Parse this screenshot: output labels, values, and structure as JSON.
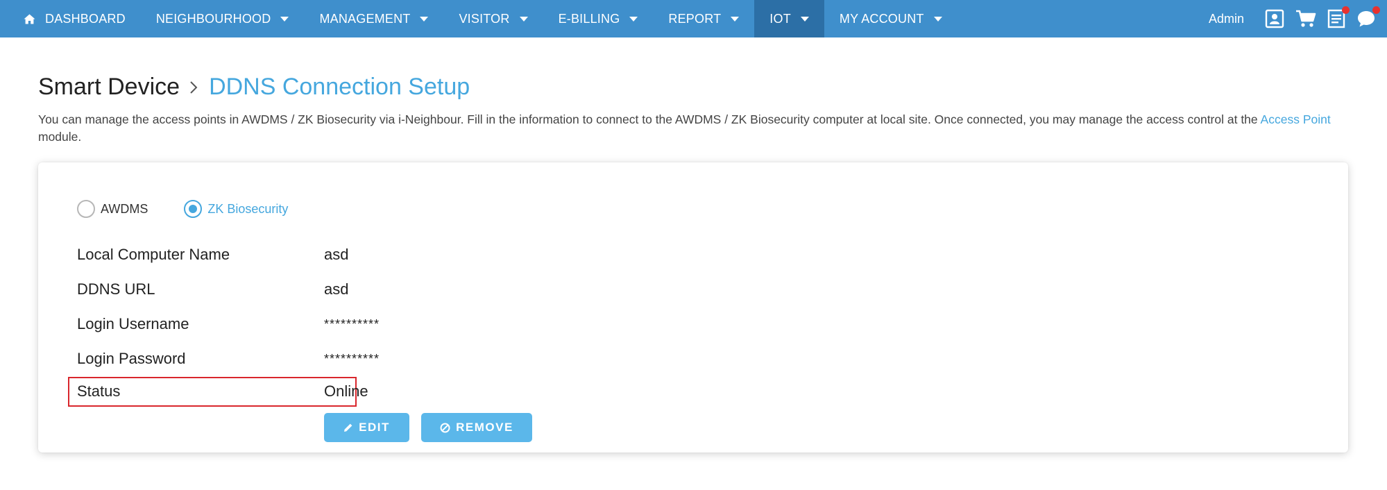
{
  "nav": {
    "items": [
      {
        "label": "DASHBOARD",
        "has_caret": false,
        "active": false
      },
      {
        "label": "NEIGHBOURHOOD",
        "has_caret": true,
        "active": false
      },
      {
        "label": "MANAGEMENT",
        "has_caret": true,
        "active": false
      },
      {
        "label": "VISITOR",
        "has_caret": true,
        "active": false
      },
      {
        "label": "E-BILLING",
        "has_caret": true,
        "active": false
      },
      {
        "label": "REPORT",
        "has_caret": true,
        "active": false
      },
      {
        "label": "IOT",
        "has_caret": true,
        "active": true
      },
      {
        "label": "MY ACCOUNT",
        "has_caret": true,
        "active": false
      }
    ],
    "admin_label": "Admin",
    "icons": [
      "contact-card-icon",
      "cart-icon",
      "document-icon",
      "chat-bubble-icon"
    ],
    "colors": {
      "bar": "#3f8fcc",
      "active": "#2c6fa6",
      "notification": "#e8322f"
    }
  },
  "header": {
    "breadcrumb_root": "Smart Device",
    "breadcrumb_current": "DDNS Connection Setup"
  },
  "description": {
    "text_before": "You can manage the access points in AWDMS / ZK Biosecurity via i-Neighbour. Fill in the information to connect to the AWDMS / ZK Biosecurity computer at local site. Once connected, you may manage the access control at the ",
    "link": "Access Point",
    "text_after": " module."
  },
  "form": {
    "radio_options": [
      {
        "label": "AWDMS",
        "selected": false
      },
      {
        "label": "ZK Biosecurity",
        "selected": true
      }
    ],
    "fields": {
      "computer_name": {
        "label": "Local Computer Name",
        "value": "asd"
      },
      "ddns_url": {
        "label": "DDNS URL",
        "value": "asd"
      },
      "username": {
        "label": "Login Username",
        "value": "**********"
      },
      "password": {
        "label": "Login Password",
        "value": "**********"
      },
      "status": {
        "label": "Status",
        "value": "Online"
      }
    },
    "edit_button": "EDIT",
    "remove_button": "REMOVE",
    "colors": {
      "accent": "#45a7de",
      "button": "#5bb7ea",
      "highlight_border": "#d9262c"
    }
  }
}
